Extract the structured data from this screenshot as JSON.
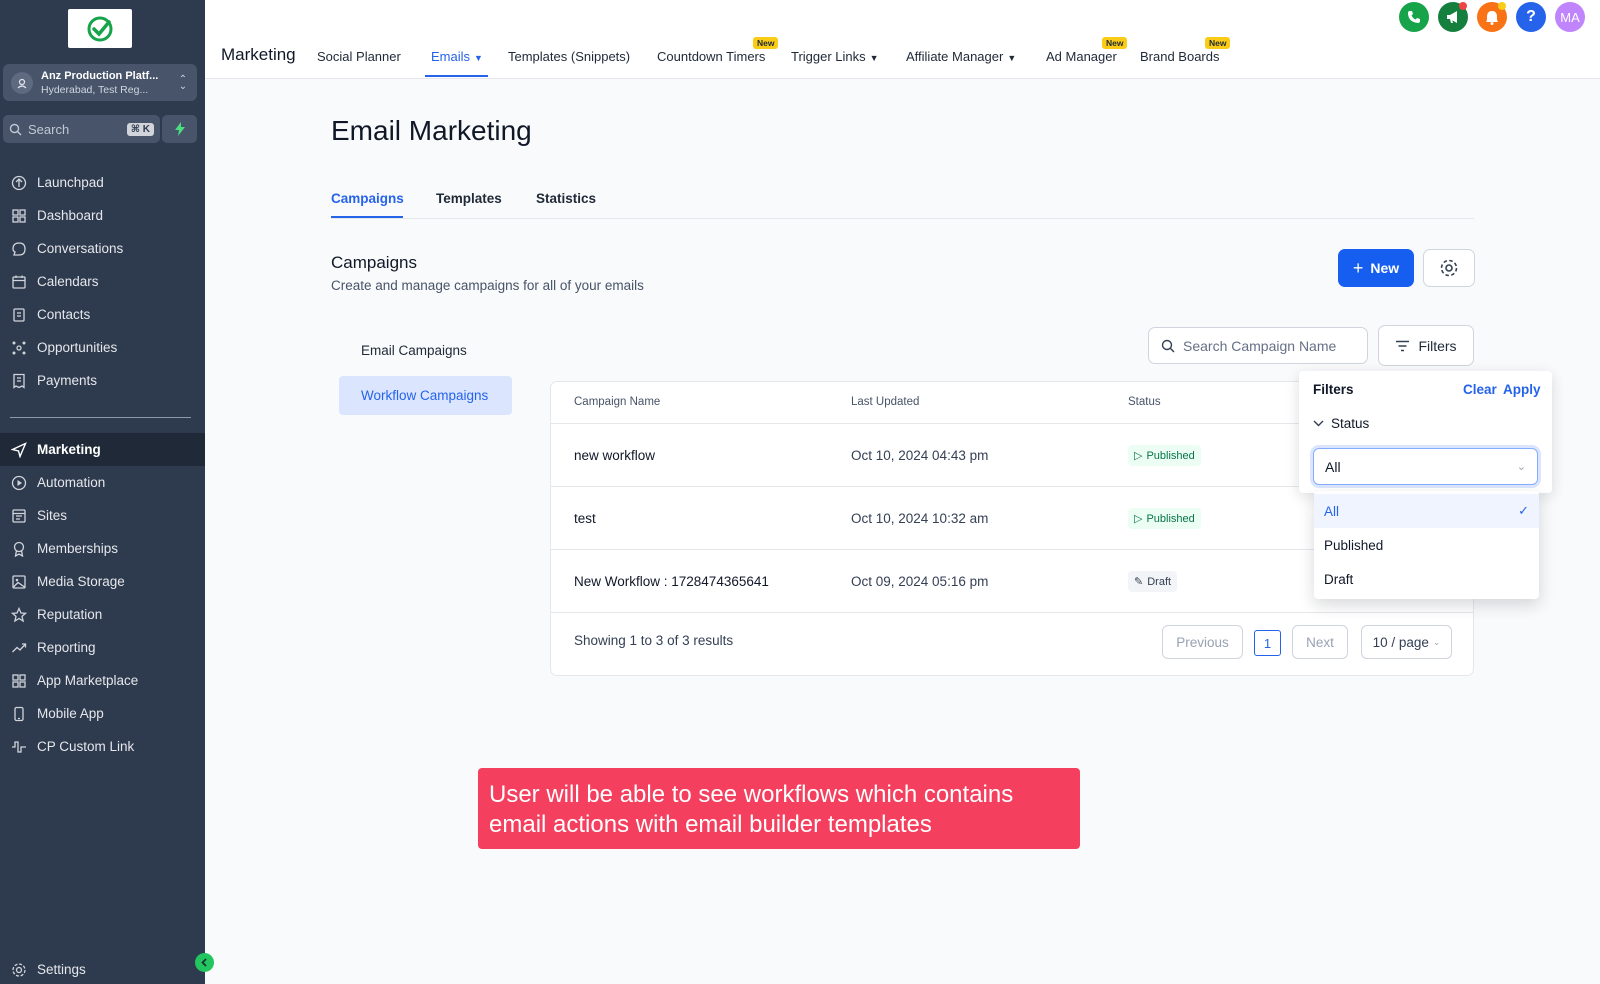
{
  "sidebar": {
    "account": {
      "name": "Anz Production Platf...",
      "location": "Hyderabad, Test Reg..."
    },
    "search": {
      "placeholder": "Search",
      "shortcut": "⌘ K"
    },
    "items": [
      {
        "label": "Launchpad",
        "icon": "rocket-icon"
      },
      {
        "label": "Dashboard",
        "icon": "grid-icon"
      },
      {
        "label": "Conversations",
        "icon": "chat-icon"
      },
      {
        "label": "Calendars",
        "icon": "calendar-icon"
      },
      {
        "label": "Contacts",
        "icon": "contacts-icon"
      },
      {
        "label": "Opportunities",
        "icon": "network-icon"
      },
      {
        "label": "Payments",
        "icon": "receipt-icon"
      },
      {
        "label": "Marketing",
        "icon": "send-icon",
        "active": true
      },
      {
        "label": "Automation",
        "icon": "automation-icon"
      },
      {
        "label": "Sites",
        "icon": "sites-icon"
      },
      {
        "label": "Memberships",
        "icon": "award-icon"
      },
      {
        "label": "Media Storage",
        "icon": "image-icon"
      },
      {
        "label": "Reputation",
        "icon": "star-icon"
      },
      {
        "label": "Reporting",
        "icon": "trend-icon"
      },
      {
        "label": "App Marketplace",
        "icon": "apps-icon"
      },
      {
        "label": "Mobile App",
        "icon": "mobile-icon"
      },
      {
        "label": "CP Custom Link",
        "icon": "pulse-icon"
      }
    ],
    "settings": {
      "label": "Settings",
      "icon": "gear-icon"
    }
  },
  "topbar": {
    "title": "Marketing",
    "tabs": [
      {
        "label": "Social Planner"
      },
      {
        "label": "Emails",
        "active": true,
        "dropdown": true
      },
      {
        "label": "Templates (Snippets)"
      },
      {
        "label": "Countdown Timers",
        "badge": "New"
      },
      {
        "label": "Trigger Links",
        "dropdown": true
      },
      {
        "label": "Affiliate Manager",
        "dropdown": true
      },
      {
        "label": "Ad Manager",
        "badge": "New"
      },
      {
        "label": "Brand Boards",
        "badge": "New"
      }
    ],
    "icons": [
      {
        "name": "phone-icon",
        "color": "#16a34a"
      },
      {
        "name": "megaphone-icon",
        "color": "#15803d"
      },
      {
        "name": "bell-icon",
        "color": "#f97316"
      },
      {
        "name": "help-icon",
        "color": "#2563eb"
      }
    ],
    "avatar_initials": "MA",
    "avatar_color": "#c084fc"
  },
  "main": {
    "title": "Email Marketing",
    "subtabs": [
      {
        "label": "Campaigns",
        "active": true
      },
      {
        "label": "Templates"
      },
      {
        "label": "Statistics"
      }
    ],
    "section": {
      "title": "Campaigns",
      "description": "Create and manage campaigns for all of your emails"
    },
    "new_button": "New",
    "campaign_types": [
      {
        "label": "Email Campaigns"
      },
      {
        "label": "Workflow Campaigns",
        "active": true
      }
    ],
    "search_placeholder": "Search Campaign Name",
    "filters_button": "Filters",
    "table": {
      "columns": [
        "Campaign Name",
        "Last Updated",
        "Status"
      ],
      "rows": [
        {
          "name": "new workflow",
          "updated": "Oct 10, 2024 04:43 pm",
          "status": "Published"
        },
        {
          "name": "test",
          "updated": "Oct 10, 2024 10:32 am",
          "status": "Published"
        },
        {
          "name": "New Workflow : 1728474365641",
          "updated": "Oct 09, 2024 05:16 pm",
          "status": "Draft"
        }
      ],
      "footer": "Showing 1 to 3 of 3 results",
      "pagination": {
        "previous": "Previous",
        "current": "1",
        "next": "Next",
        "per_page": "10 / page"
      }
    },
    "filter_panel": {
      "title": "Filters",
      "clear": "Clear",
      "apply": "Apply",
      "status_label": "Status",
      "selected": "All",
      "options": [
        "All",
        "Published",
        "Draft"
      ]
    },
    "callout": "User will be able to see workflows which contains email actions with email builder templates"
  },
  "colors": {
    "accent": "#2563eb",
    "sidebar": "#2e3a4e",
    "callout": "#f43f5e"
  }
}
